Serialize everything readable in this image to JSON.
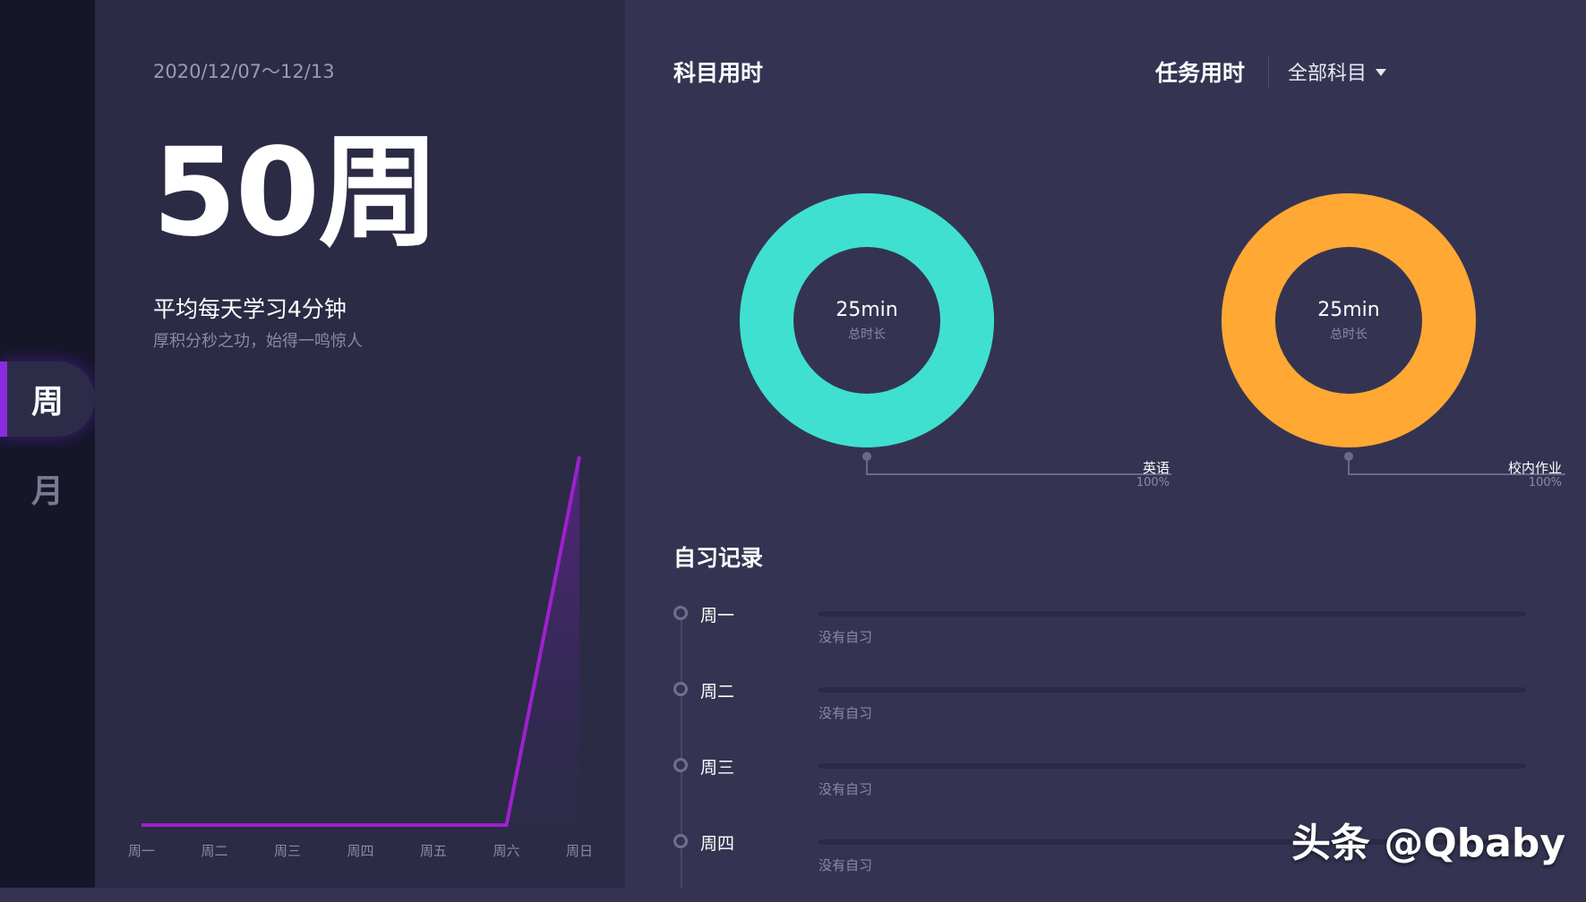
{
  "sidebar": {
    "tabs": [
      {
        "label": "周",
        "active": true
      },
      {
        "label": "月",
        "active": false
      }
    ]
  },
  "summary": {
    "date_range": "2020/12/07～12/13",
    "week_number": "50周",
    "avg_study": "平均每天学习4分钟",
    "motto": "厚积分秒之功，始得一鸣惊人"
  },
  "chart_data": {
    "type": "line",
    "categories": [
      "周一",
      "周二",
      "周三",
      "周四",
      "周五",
      "周六",
      "周日"
    ],
    "series": [
      {
        "values": [
          0,
          0,
          0,
          0,
          0,
          0,
          25
        ],
        "color": "#a020d0"
      }
    ]
  },
  "subject_time": {
    "title": "科目用时",
    "donut": {
      "value": "25min",
      "label": "总时长",
      "color": "#3fe0d0",
      "slices": [
        {
          "name": "英语",
          "percent": "100%"
        }
      ]
    }
  },
  "task_time": {
    "title": "任务用时",
    "filter": "全部科目",
    "donut": {
      "value": "25min",
      "label": "总时长",
      "color": "#ffa833",
      "slices": [
        {
          "name": "校内作业",
          "percent": "100%"
        }
      ]
    }
  },
  "self_study": {
    "title": "自习记录",
    "records": [
      {
        "day": "周一",
        "status": "没有自习"
      },
      {
        "day": "周二",
        "status": "没有自习"
      },
      {
        "day": "周三",
        "status": "没有自习"
      },
      {
        "day": "周四",
        "status": "没有自习"
      }
    ]
  },
  "watermark": "头条 @Qbaby",
  "colors": {
    "background": "#343452",
    "panel": "#2b2b46",
    "sidebar": "#161629",
    "accent": "#8a2be2"
  }
}
